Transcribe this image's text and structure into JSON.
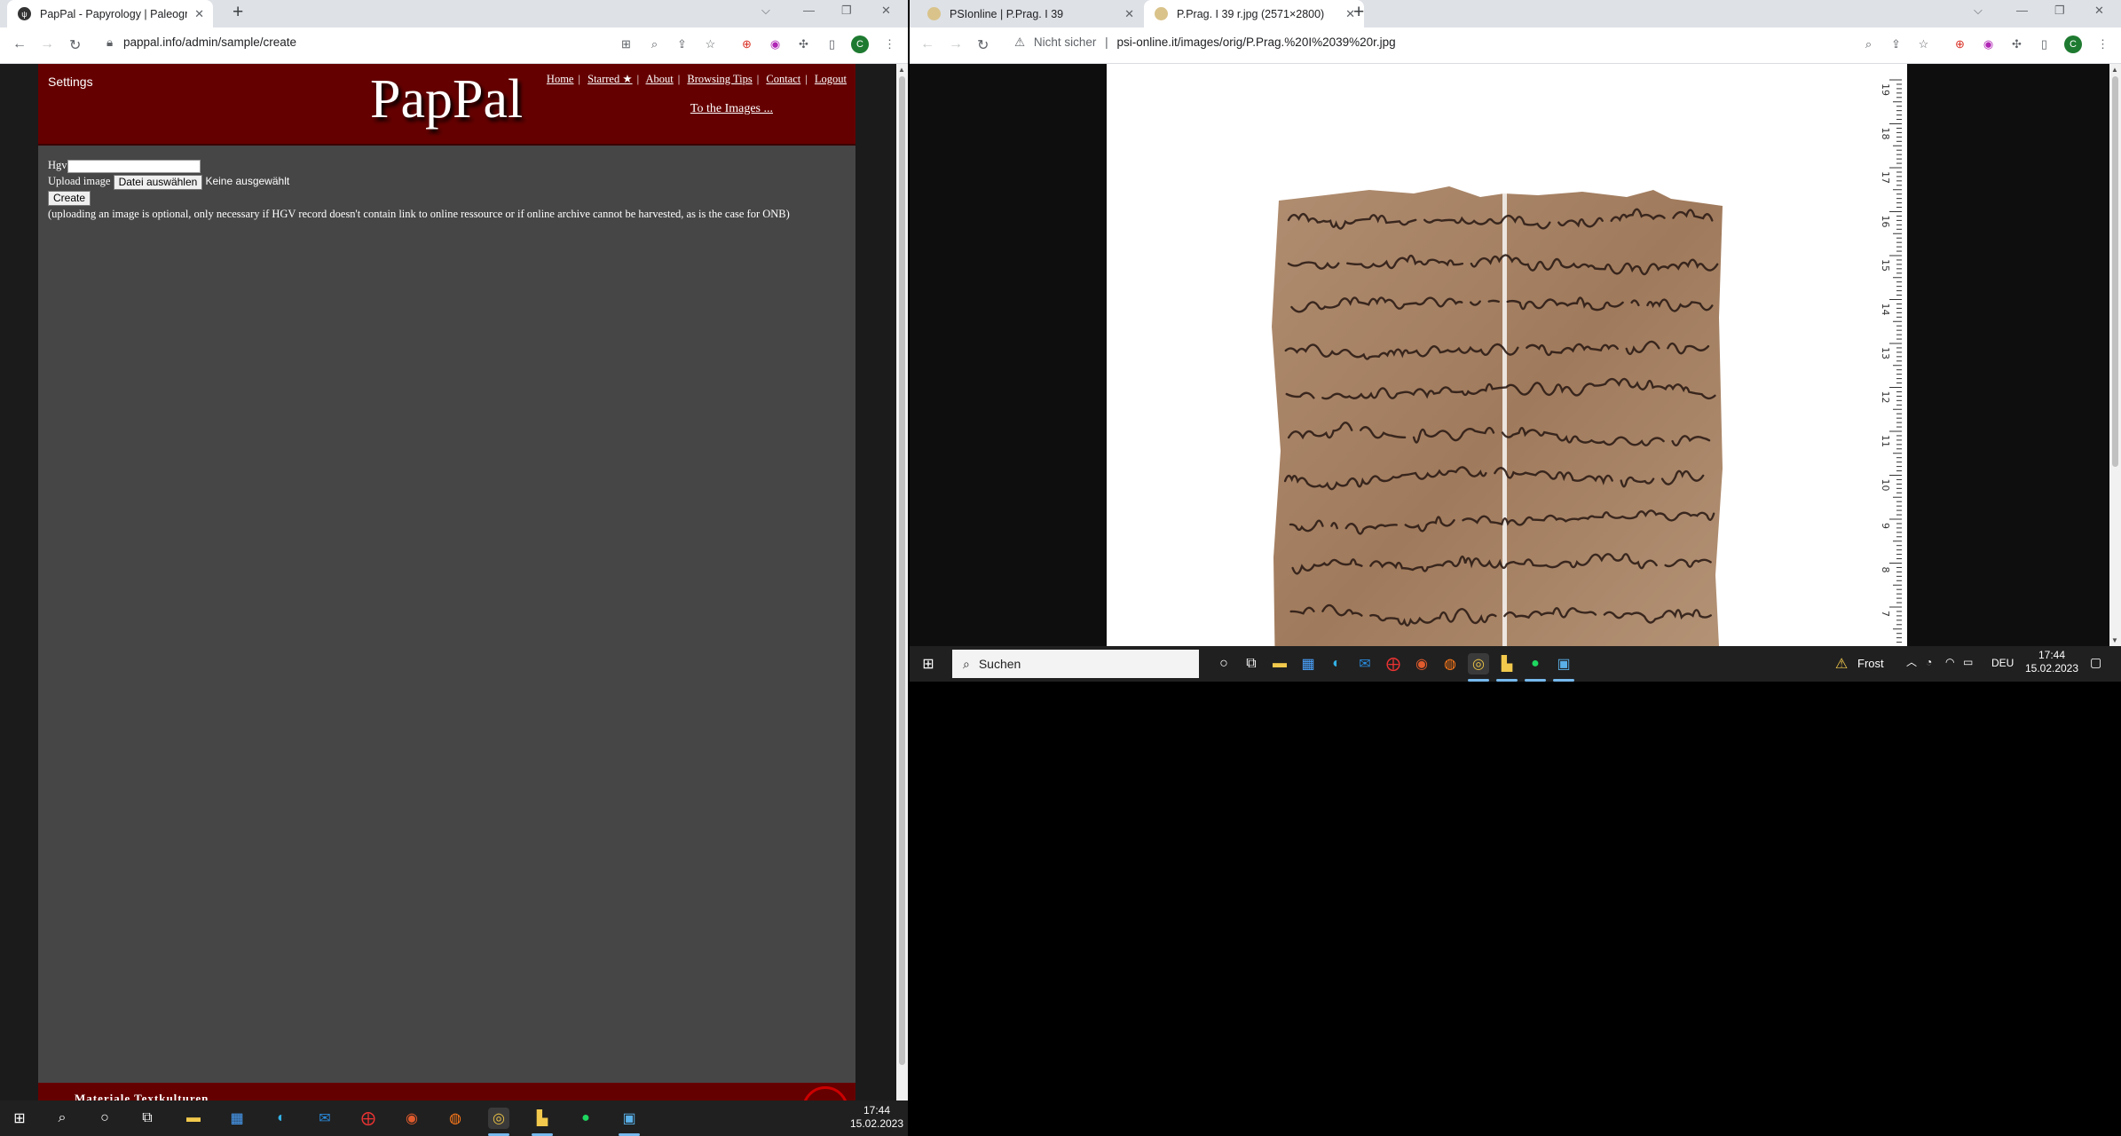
{
  "left_window": {
    "tab": {
      "title": "PapPal - Papyrology | Paleograph"
    },
    "address": "pappal.info/admin/sample/create",
    "page": {
      "settings_label": "Settings",
      "logo": "PapPal",
      "menu": [
        {
          "label": "Home"
        },
        {
          "label": "Starred ★"
        },
        {
          "label": "About"
        },
        {
          "label": "Browsing Tips"
        },
        {
          "label": "Contact"
        },
        {
          "label": "Logout"
        }
      ],
      "images_link": "To the Images ...",
      "form": {
        "hgv_label": "Hgv",
        "hgv_value": "",
        "upload_label": "Upload image",
        "choose_file_button": "Datei auswählen",
        "no_file_text": "Keine ausgewählt",
        "create_button": "Create",
        "note": "(uploading an image is optional, only necessary if HGV record doesn't contain link to online ressource or if online archive cannot be harvested, as is the case for ONB)"
      },
      "footer_text": "Materiale Textkulturen"
    }
  },
  "right_window": {
    "tabs": [
      {
        "title": "PSIonline | P.Prag. I 39"
      },
      {
        "title": "P.Prag. I 39 r.jpg (2571×2800)"
      }
    ],
    "security_label": "Nicht sicher",
    "address": "psi-online.it/images/orig/P.Prag.%20I%2039%20r.jpg",
    "ruler_labels": [
      "19",
      "18",
      "17",
      "16",
      "15",
      "14",
      "13",
      "12",
      "11",
      "10",
      "9",
      "8",
      "7"
    ]
  },
  "taskbar_right": {
    "search_placeholder": "Suchen",
    "weather": "Frost",
    "language": "DEU",
    "time": "17:44",
    "date": "15.02.2023"
  },
  "taskbar_left": {
    "time": "17:44",
    "date": "15.02.2023"
  },
  "colors": {
    "pappal_header": "#650000",
    "pappal_body": "#464646",
    "papyrus": "#a9866a"
  }
}
